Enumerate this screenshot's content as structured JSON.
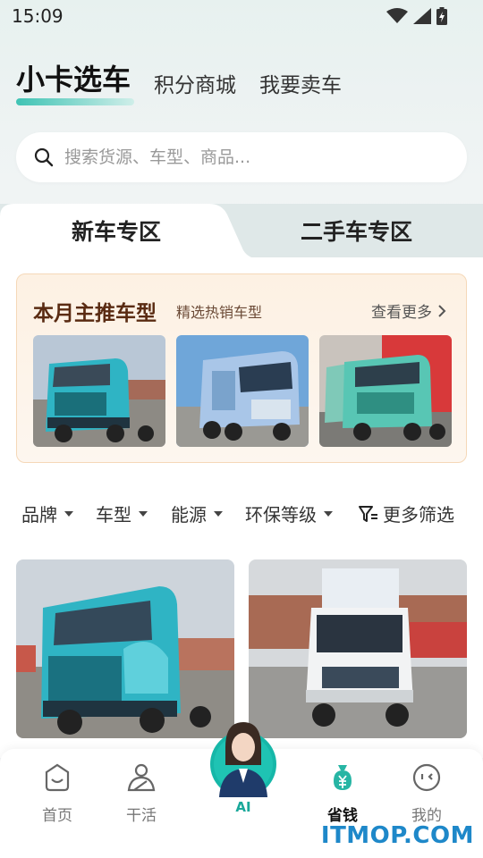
{
  "status_bar": {
    "time": "15:09"
  },
  "top_tabs": {
    "active": "小卡选车",
    "tab2": "积分商城",
    "tab3": "我要卖车"
  },
  "search": {
    "placeholder": "搜索货源、车型、商品..."
  },
  "zones": {
    "new": "新车专区",
    "used": "二手车专区"
  },
  "promo": {
    "title": "本月主推车型",
    "subtitle": "精选热销车型",
    "more": "查看更多"
  },
  "filters": {
    "brand": "品牌",
    "model": "车型",
    "energy": "能源",
    "emission": "环保等级",
    "more": "更多筛选"
  },
  "nav": {
    "home": "首页",
    "work": "干活",
    "ai": "AI",
    "save": "省钱",
    "mine": "我的"
  },
  "watermark": "ITMOP.COM",
  "colors": {
    "accent": "#3fc3b4",
    "promo_title": "#5a2b12",
    "watermark": "#1e88c9",
    "truck_teal": "#2fb4c4"
  }
}
